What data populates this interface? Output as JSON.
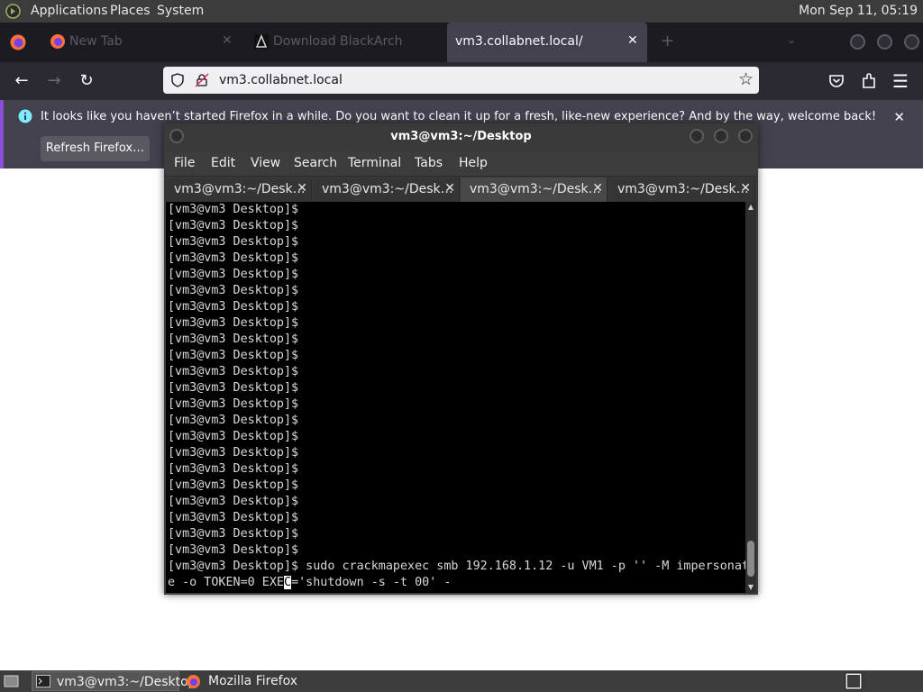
{
  "top_panel": {
    "menus": [
      "Applications",
      "Places",
      "System"
    ],
    "clock": "Mon Sep 11, 05:19"
  },
  "firefox": {
    "tabs": [
      {
        "label": "New Tab"
      },
      {
        "label": "Download BlackArch"
      },
      {
        "label": "vm3.collabnet.local/",
        "active": true
      }
    ],
    "url": "vm3.collabnet.local",
    "notification": {
      "text": "It looks like you haven’t started Firefox in a while. Do you want to clean it up for a fresh, like-new experience? And by the way, welcome back!",
      "button": "Refresh Firefox…"
    }
  },
  "terminal": {
    "title": "vm3@vm3:~/Desktop",
    "menu": [
      "File",
      "Edit",
      "View",
      "Search",
      "Terminal",
      "Tabs",
      "Help"
    ],
    "tabs": [
      "vm3@vm3:~/Desk…",
      "vm3@vm3:~/Desk…",
      "vm3@vm3:~/Desk…",
      "vm3@vm3:~/Desk…"
    ],
    "active_tab_index": 2,
    "prompt": "[vm3@vm3 Desktop]$",
    "empty_prompt_count": 22,
    "command_line_1": "[vm3@vm3 Desktop]$ sudo crackmapexec smb 192.168.1.12 -u VM1 -p '' -M impersonat",
    "command_line_2_before_cursor": "e -o TOKEN=0 EXE",
    "command_line_2_cursor_char": "C",
    "command_line_2_after_cursor": "='shutdown -s -t 00' -"
  },
  "taskbar": {
    "items": [
      {
        "label": "vm3@vm3:~/Desktop",
        "active": true
      },
      {
        "label": "Mozilla Firefox",
        "active": false
      }
    ]
  },
  "colors": {
    "panel": "#3c3c3c",
    "firefox_tabbar": "#1c1b22",
    "firefox_navbar": "#2b2a33",
    "notification_bg": "#42414d",
    "notification_accent": "#8a4fd6",
    "terminal_bg": "#000000",
    "terminal_text": "#d8d8d8"
  }
}
